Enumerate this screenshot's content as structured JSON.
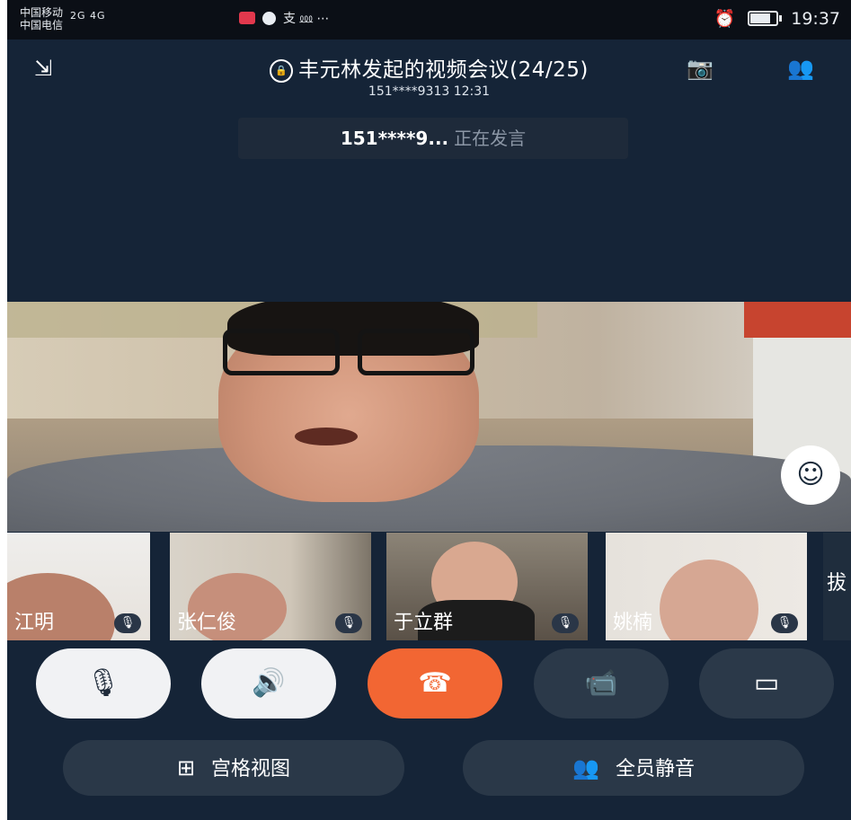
{
  "status_bar": {
    "carrier1": "中国移动",
    "carrier2": "中国电信",
    "network": "2G 4G",
    "extra_text": "支 ⅏ ⋯",
    "time": "19:37",
    "alarm_icon": "alarm-icon",
    "battery_icon": "battery-icon"
  },
  "header": {
    "title": "丰元林发起的视频会议(24/25)",
    "subtitle": "151****9313 12:31",
    "minimize_icon": "minimize-arrows-icon",
    "switch_camera_icon": "switch-camera-icon",
    "add_member_icon": "add-member-icon"
  },
  "speaking_banner": {
    "name": "151****9...",
    "status": "正在发言"
  },
  "participants": [
    {
      "name": "江明",
      "mic": "muted"
    },
    {
      "name": "张仁俊",
      "mic": "muted"
    },
    {
      "name": "于立群",
      "mic": "muted"
    },
    {
      "name": "姚楠",
      "mic": "muted"
    },
    {
      "name": "拔",
      "mic": "muted"
    }
  ],
  "controls": {
    "mute_icon": "mic-off-icon",
    "speaker_icon": "speaker-icon",
    "hangup_icon": "hang-up-icon",
    "camera_icon": "video-camera-icon",
    "screenshare_icon": "screen-share-icon"
  },
  "bottom_buttons": {
    "grid_view": "宫格视图",
    "mute_all": "全员静音"
  },
  "colors": {
    "background": "#152437",
    "hangup": "#f26633",
    "button_dark": "#2b3949",
    "button_light": "#f1f2f4"
  }
}
